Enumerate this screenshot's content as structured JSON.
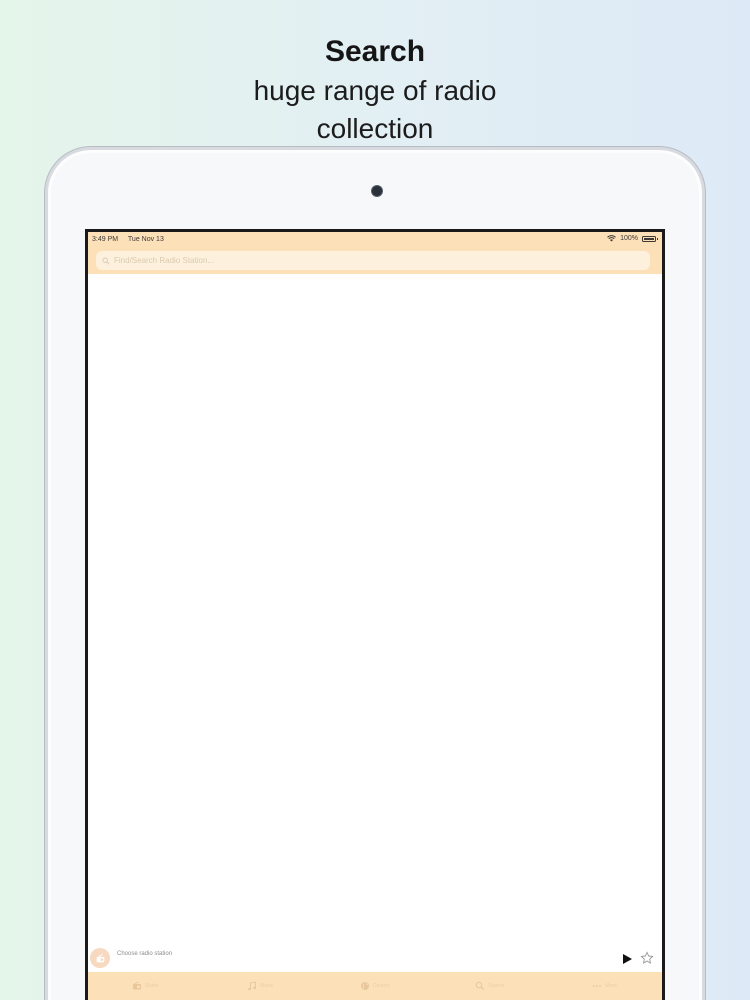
{
  "headline": {
    "title": "Search",
    "subtitle_line1": "huge range of radio",
    "subtitle_line2": "collection"
  },
  "status_bar": {
    "time": "3:49 PM",
    "date": "Tue Nov 13",
    "battery": "100%"
  },
  "search": {
    "placeholder": "Find/Search Radio Station..."
  },
  "mini_player": {
    "station_label": "Choose radio station"
  },
  "tabs": [
    {
      "label": "Radio",
      "icon": "radio-icon"
    },
    {
      "label": "Music",
      "icon": "music-note-icon"
    },
    {
      "label": "Country",
      "icon": "globe-icon"
    },
    {
      "label": "Search",
      "icon": "search-icon"
    },
    {
      "label": "More",
      "icon": "more-icon"
    }
  ],
  "colors": {
    "accent": "#fbe0b8",
    "tab_icon": "#e8c79a",
    "background_left": "#e4f5ea",
    "background_right": "#dde9f6"
  }
}
